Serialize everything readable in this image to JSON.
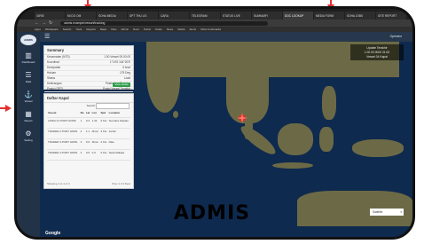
{
  "browser": {
    "tabs": [
      "GIRIS",
      "MI DO OM",
      "SOHA MEDIA",
      "DPT THU LIS",
      "CARA",
      "TELEGRAM",
      "STATUS LIVE",
      "SUMMARY",
      "DOC LOOKUP",
      "MEDIA FORM",
      "SOHA JOBS",
      "SITE REPORT"
    ],
    "active_tab_index": 8,
    "url": "admis.example/vessel/tracking",
    "bookmarks": [
      "Apps",
      "Workspace",
      "Search",
      "Tools",
      "Reports",
      "Maps",
      "Files",
      "Admin",
      "Docs",
      "Portal",
      "Guide",
      "News",
      "Media",
      "Alerts",
      "Other bookmarks"
    ]
  },
  "sidebar": {
    "logo": "ADMIS",
    "items": [
      {
        "icon": "▥",
        "label": "Dashboard"
      },
      {
        "icon": "☰",
        "label": "Data"
      },
      {
        "icon": "⚓",
        "label": "Vessel"
      },
      {
        "icon": "▦",
        "label": "Report"
      },
      {
        "icon": "⚙",
        "label": "Setting"
      }
    ]
  },
  "header": {
    "user": "Operator"
  },
  "info_panel": {
    "title": "Summary",
    "rows": [
      {
        "k": "Kecamatan (NTS)",
        "v": "1.00 Vessel 00.00.00"
      },
      {
        "k": "Koordinat",
        "v": "1°10'S 104°20'E"
      },
      {
        "k": "Kecepatan",
        "v": "0 knot"
      },
      {
        "k": "Haluan",
        "v": "175 Deg"
      },
      {
        "k": "Status",
        "v": "Load"
      },
      {
        "k": "Keterangan",
        "v": "Pelabuhan Sumatra"
      },
      {
        "k": "Posisi (GPT)",
        "v": "Posisi Vessel Terakhir"
      }
    ],
    "button": "View Detail"
  },
  "table_panel": {
    "title": "Daftar Kapal",
    "search_label": "Search:",
    "headers": [
      "Vessel",
      "No",
      "Lat",
      "Lon",
      "Spd",
      "Location"
    ],
    "rows": [
      [
        "LINDA V1 PORT HOPE",
        "1",
        "0.3",
        "1.34",
        "6 Kts",
        "Sumatra Selatan"
      ],
      [
        "TRADER 2 PORT HOPE",
        "2",
        "1.1",
        "Mnon",
        "3 Kts",
        "Jambi"
      ],
      [
        "TRADER 3 PORT HOPE",
        "3",
        "0.9",
        "Mnon",
        "2 Kts",
        "Riau"
      ],
      [
        "TRADER 4 PORT HOPE",
        "4",
        "0.5",
        "0.0",
        "0 Kts",
        "Selat Malaka"
      ]
    ],
    "pager_left": "Showing 1 to 4 of 4",
    "pager_right": "Prev 1 2 3 Next"
  },
  "map": {
    "overlay_lines": [
      "Update Terakhir",
      "1.00.00.0000 01:00",
      "Vessel 04 Kapal"
    ],
    "map_type": "Satellite",
    "brand": "Google"
  },
  "caption": "ADMIS"
}
